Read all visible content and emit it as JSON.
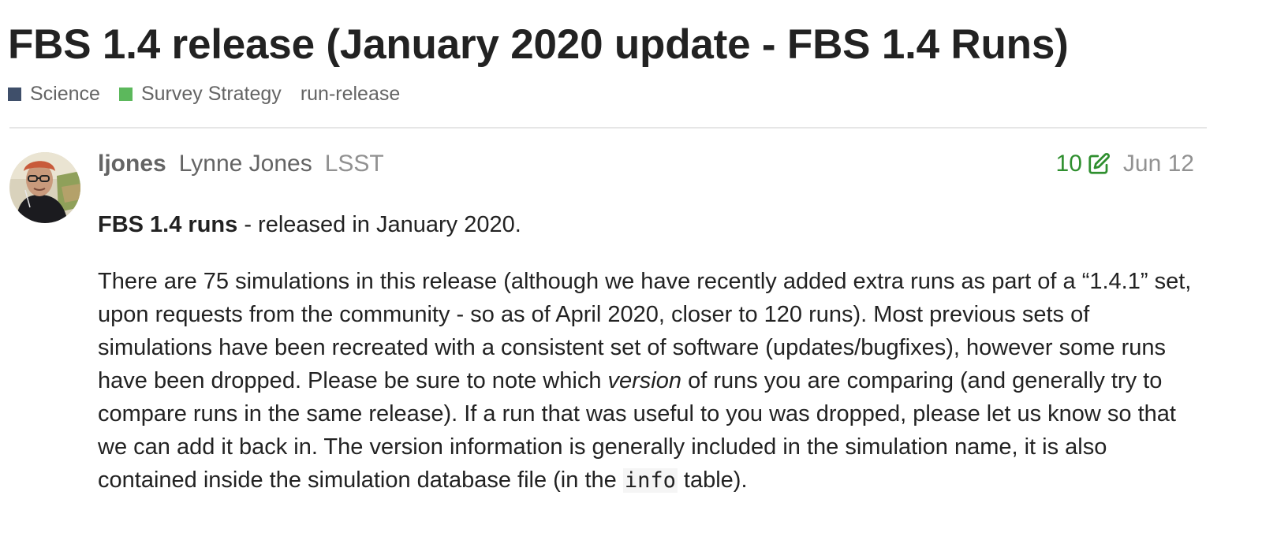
{
  "topic": {
    "title": "FBS 1.4 release (January 2020 update - FBS 1.4 Runs)",
    "categories": [
      {
        "name": "Science",
        "color": "#3f4f6a"
      },
      {
        "name": "Survey Strategy",
        "color": "#5cb85c"
      }
    ],
    "tags": [
      "run-release"
    ]
  },
  "post": {
    "avatar_icon": "user-avatar",
    "username": "ljones",
    "full_name": "Lynne Jones",
    "user_title": "LSST",
    "edit_count": "10",
    "edit_icon": "pencil-square-icon",
    "date": "Jun 12",
    "lead_bold": "FBS 1.4 runs",
    "lead_rest": " - released in January 2020.",
    "para_1": "There are 75 simulations in this release (although we have recently added extra runs as part of a “1.4.1” set, upon requests from the community - so as of April 2020, closer to 120 runs). Most previous sets of simulations have been recreated with a consistent set of software (updates/bugfixes), however some runs have been dropped. Please be sure to note which ",
    "para_1_em": "version",
    "para_1_b": " of runs you are comparing (and generally try to compare runs in the same release). If a run that was useful to you was dropped, please let us know so that we can add it back in. The version information is generally included in the simulation name, it is also contained inside the simulation database file (in the ",
    "para_1_code": "info",
    "para_1_c": " table)."
  },
  "colors": {
    "edit_green": "#2f8f2f",
    "muted_text": "#919191",
    "divider": "#e6e6e6"
  }
}
